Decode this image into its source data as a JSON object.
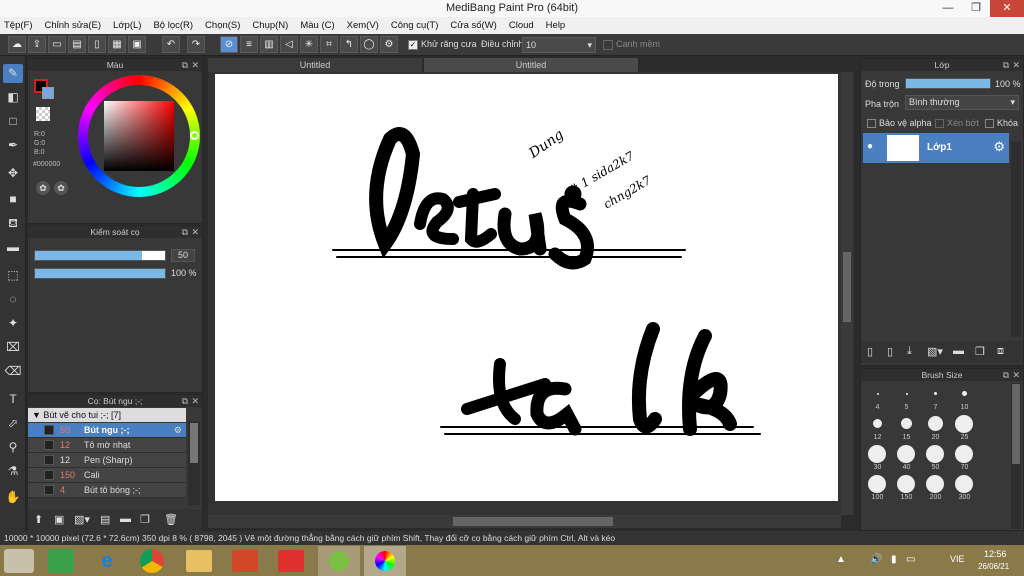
{
  "app": {
    "title": "MediBang Paint Pro (64bit)"
  },
  "menu": [
    "Tệp(F)",
    "Chỉnh sửa(E)",
    "Lớp(L)",
    "Bộ lọc(R)",
    "Chọn(S)",
    "Chụp(N)",
    "Màu (C)",
    "Xem(V)",
    "Công cụ(T)",
    "Cửa số(W)",
    "Cloud",
    "Help"
  ],
  "toolbar": {
    "antialias_label": "Khử răng cưa",
    "adjust_label": "Điều chỉnh",
    "adjust_value": "10",
    "snap_label": "Canh mềm"
  },
  "tabs": [
    "Untitled",
    "Untitled"
  ],
  "color_panel": {
    "title": "Màu",
    "r": "R:0",
    "g": "G:0",
    "b": "B:0",
    "hex": "#000000",
    "colors": {
      "primary": "#000000",
      "accent": "#d62020"
    }
  },
  "brush_control": {
    "title": "Kiểm soát cọ",
    "size_value": "50",
    "opacity_value": "100 %",
    "size_fraction": 0.82,
    "opacity_fraction": 1.0
  },
  "brush_panel": {
    "title": "Cọ: Bút ngu ;-;",
    "group": "Bút vẽ cho tui ;-; [7]",
    "items": [
      {
        "size": "50",
        "name": "Bút ngu ;-;",
        "selected": true,
        "red": true
      },
      {
        "size": "12",
        "name": "Tô mờ nhạt",
        "selected": false,
        "red": true
      },
      {
        "size": "12",
        "name": "Pen (Sharp)",
        "selected": false,
        "red": false
      },
      {
        "size": "150",
        "name": "Cali",
        "selected": false,
        "red": true
      },
      {
        "size": "4",
        "name": "Bút tô bóng ;-;",
        "selected": false,
        "red": true
      }
    ]
  },
  "layer_panel": {
    "title": "Lớp",
    "opacity_label": "Độ trong",
    "opacity_value": "100 %",
    "opacity_fraction": 1.0,
    "blend_label": "Pha trộn",
    "blend_value": "Bình thường",
    "protect_alpha": "Bảo vệ alpha",
    "clip": "Xén bớt",
    "lock": "Khóa",
    "layer_name": "Lớp1"
  },
  "brush_size_panel": {
    "title": "Brush Size",
    "sizes": [
      "4",
      "5",
      "7",
      "10",
      "12",
      "15",
      "20",
      "25",
      "30",
      "40",
      "50",
      "70",
      "100",
      "150",
      "200",
      "300"
    ]
  },
  "status": {
    "text": "10000 * 10000 pixel   (72.6 * 72.6cm)   350 dpi   8 %   ( 8798, 2045 )   Vẽ một đường thẳng bằng cách giữ phím Shift, Thay đổi cỡ cọ bằng cách giữ phím Ctrl, Alt và kéo"
  },
  "taskbar": {
    "lang": "VIE",
    "time": "12:56",
    "date": "26/06/21"
  },
  "canvas": {
    "words": [
      "lets",
      "talk"
    ],
    "signature_lines": [
      "Dung",
      "# 1 sida2k7",
      "chng2k7"
    ]
  }
}
